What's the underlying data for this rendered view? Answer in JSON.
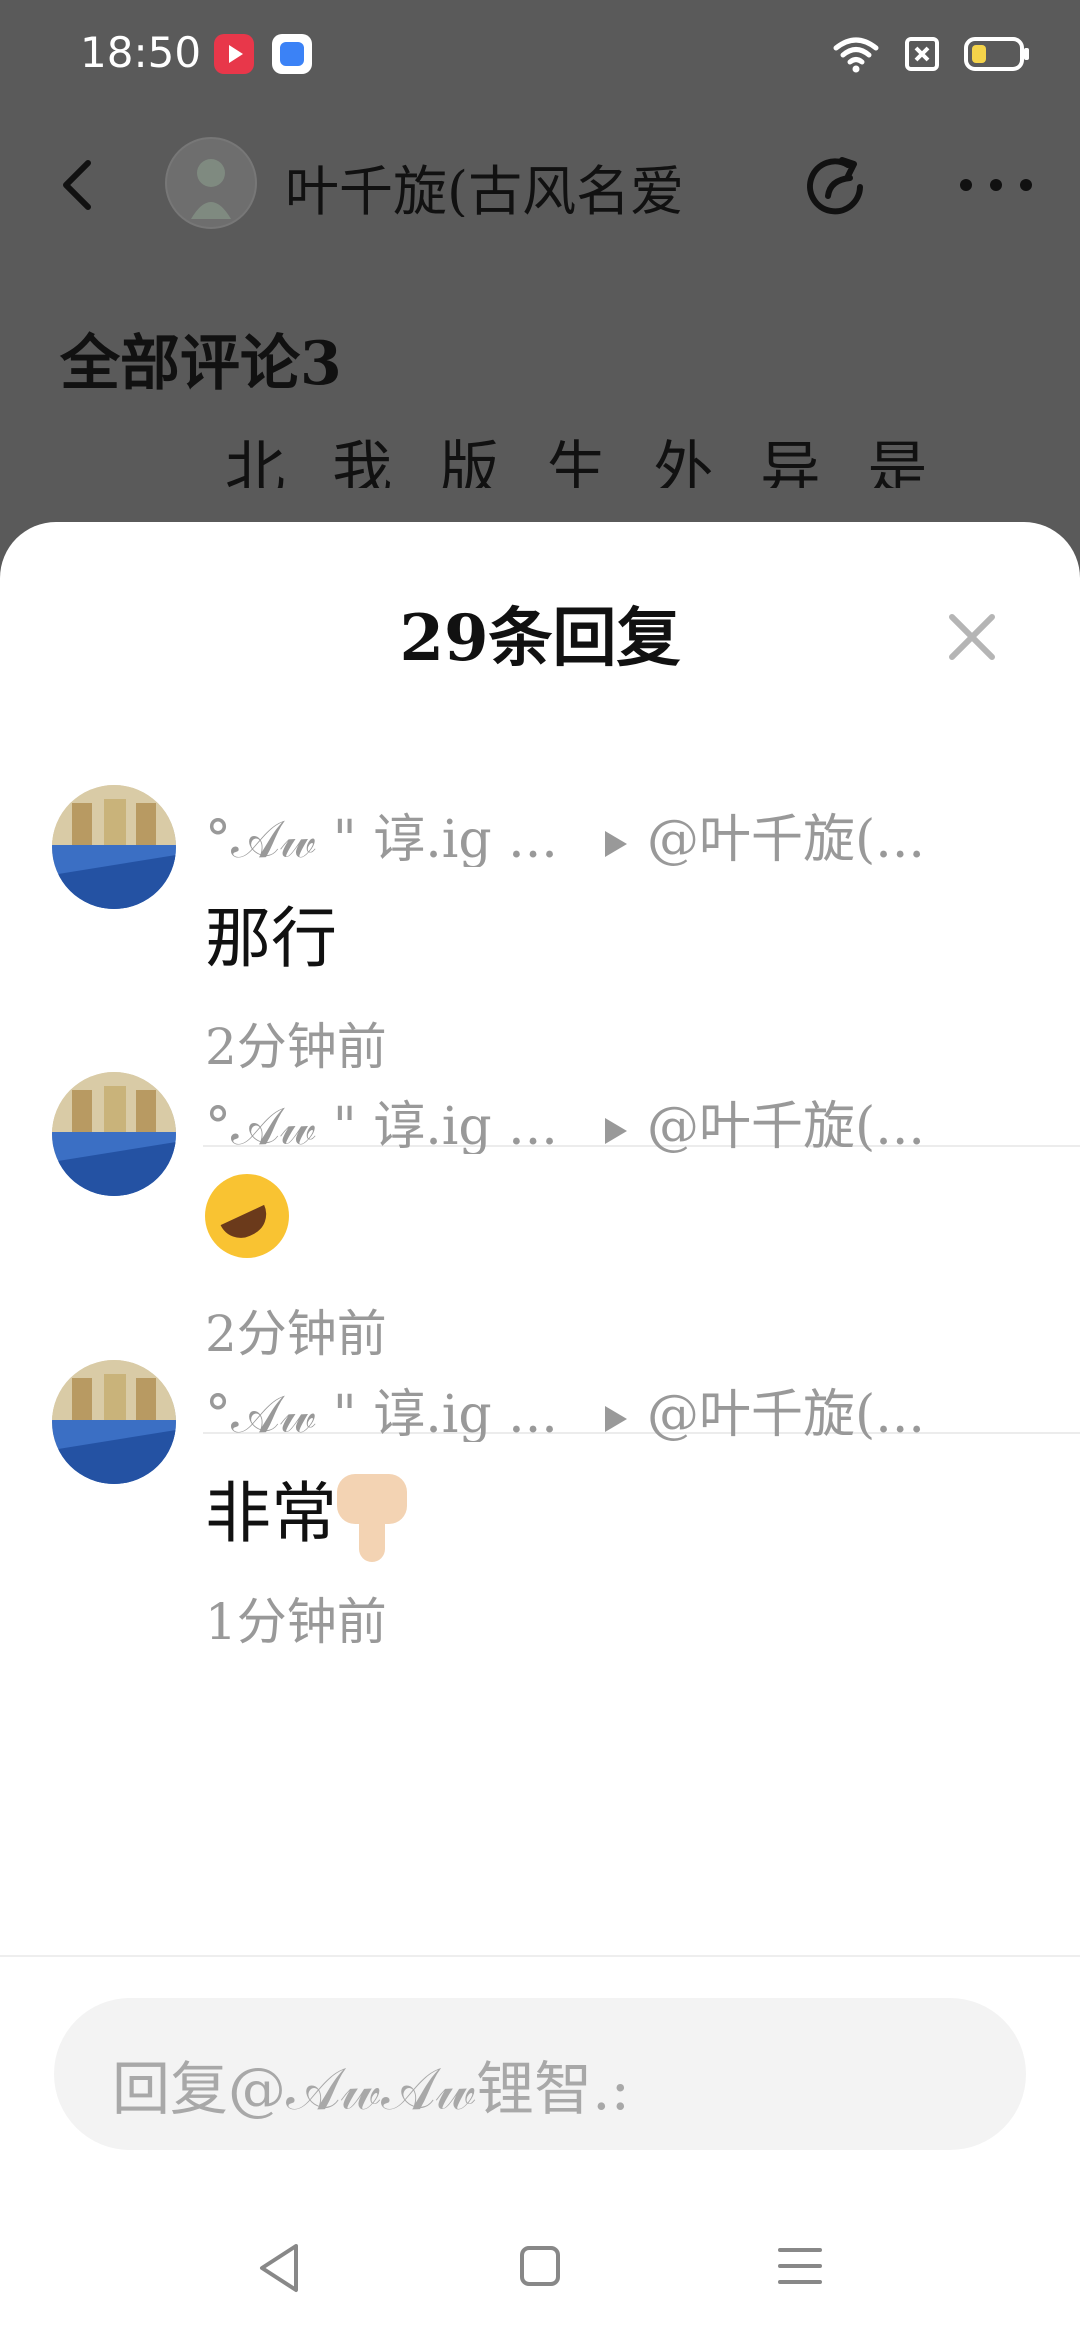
{
  "status_bar": {
    "time": "18:50"
  },
  "header": {
    "title": "叶千旋(古风名爱",
    "section_title": "全部评论3",
    "background_snippet": "北 我 版 生 外 异 是 人 论"
  },
  "sheet": {
    "title": "29条回复",
    "replies": [
      {
        "author": "°𝒜𝓌 \" 谆.ig ...",
        "target": "@叶千旋(...",
        "content": "那行",
        "time": "2分钟前"
      },
      {
        "author": "°𝒜𝓌 \" 谆.ig ...",
        "target": "@叶千旋(...",
        "content": "",
        "emoji": "rolling-on-floor-laughing-icon",
        "time": "2分钟前"
      },
      {
        "author": "°𝒜𝓌 \" 谆.ig ...",
        "target": "@叶千旋(...",
        "content": "非常",
        "emoji": "thumbs-down-icon",
        "time": "1分钟前"
      }
    ],
    "input_placeholder": "回复@𝒜𝓌𝒜𝓌锂智.:"
  },
  "colors": {
    "overlay": "#5a5a5a",
    "meta_text": "#999999",
    "input_bg": "#f3f3f3"
  }
}
